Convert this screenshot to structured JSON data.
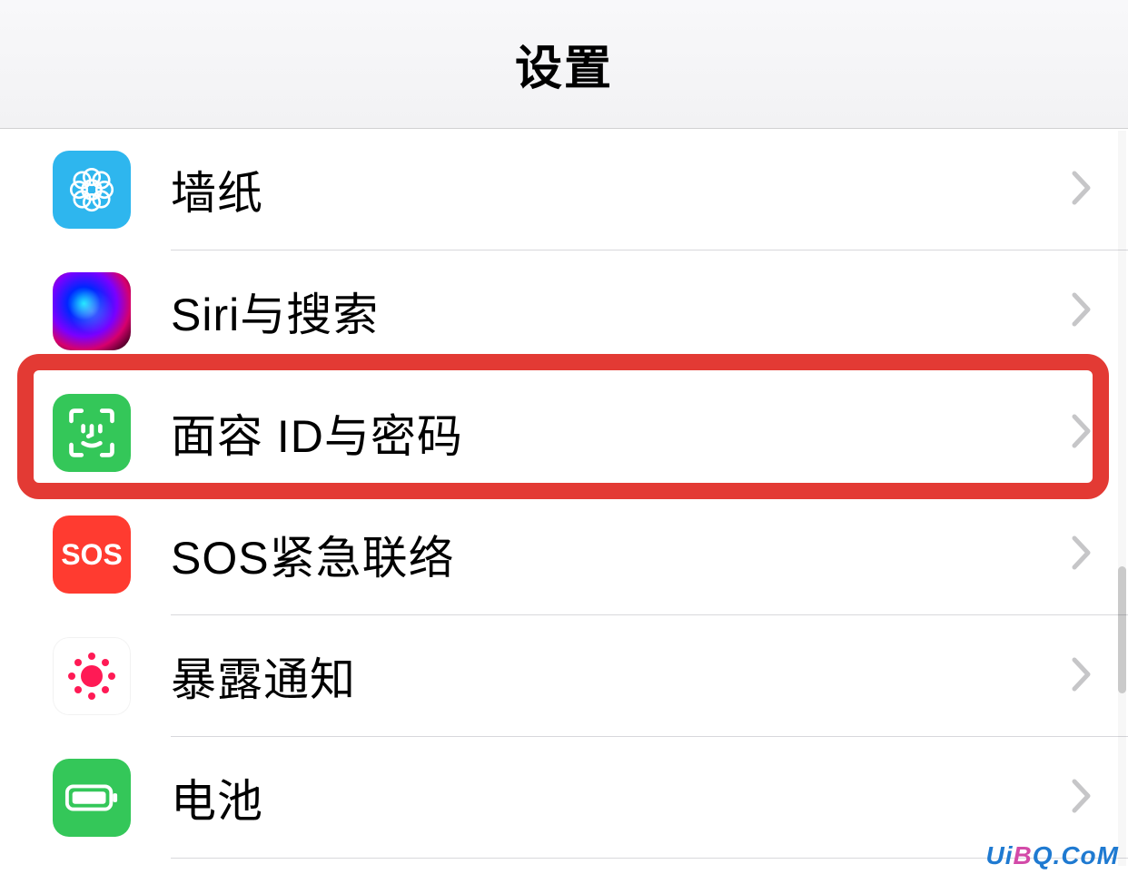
{
  "header": {
    "title": "设置"
  },
  "rows": [
    {
      "id": "wallpaper",
      "label": "墙纸",
      "icon": "wallpaper-icon"
    },
    {
      "id": "siri",
      "label": "Siri与搜索",
      "icon": "siri-icon"
    },
    {
      "id": "faceid",
      "label": "面容 ID与密码",
      "icon": "faceid-icon",
      "highlighted": true
    },
    {
      "id": "sos",
      "label": "SOS紧急联络",
      "icon": "sos-icon",
      "icon_text": "SOS"
    },
    {
      "id": "exposure",
      "label": "暴露通知",
      "icon": "exposure-icon"
    },
    {
      "id": "battery",
      "label": "电池",
      "icon": "battery-icon"
    }
  ],
  "watermark": {
    "part1": "U",
    "part2": "i",
    "part3": "B",
    "part4": "Q.CoM"
  }
}
